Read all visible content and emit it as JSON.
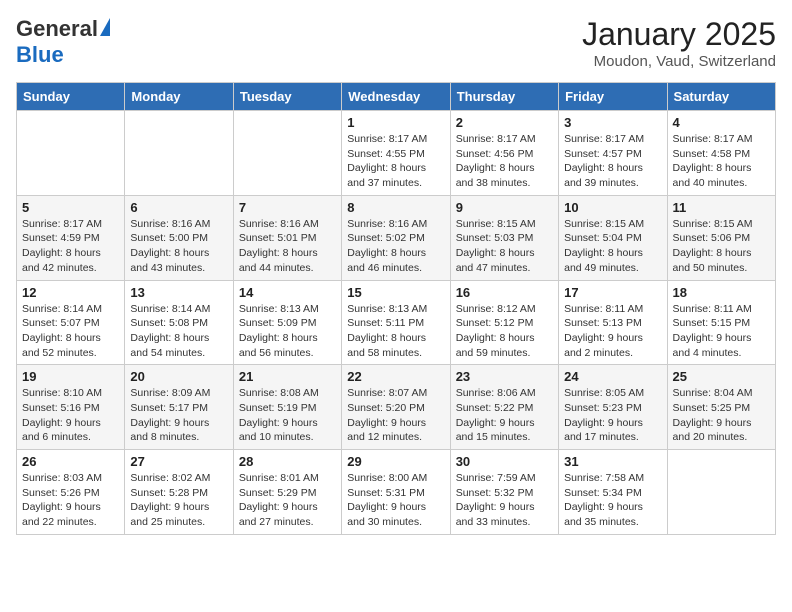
{
  "header": {
    "logo_general": "General",
    "logo_blue": "Blue",
    "title": "January 2025",
    "location": "Moudon, Vaud, Switzerland"
  },
  "days_of_week": [
    "Sunday",
    "Monday",
    "Tuesday",
    "Wednesday",
    "Thursday",
    "Friday",
    "Saturday"
  ],
  "weeks": [
    [
      {
        "day": "",
        "info": ""
      },
      {
        "day": "",
        "info": ""
      },
      {
        "day": "",
        "info": ""
      },
      {
        "day": "1",
        "info": "Sunrise: 8:17 AM\nSunset: 4:55 PM\nDaylight: 8 hours and 37 minutes."
      },
      {
        "day": "2",
        "info": "Sunrise: 8:17 AM\nSunset: 4:56 PM\nDaylight: 8 hours and 38 minutes."
      },
      {
        "day": "3",
        "info": "Sunrise: 8:17 AM\nSunset: 4:57 PM\nDaylight: 8 hours and 39 minutes."
      },
      {
        "day": "4",
        "info": "Sunrise: 8:17 AM\nSunset: 4:58 PM\nDaylight: 8 hours and 40 minutes."
      }
    ],
    [
      {
        "day": "5",
        "info": "Sunrise: 8:17 AM\nSunset: 4:59 PM\nDaylight: 8 hours and 42 minutes."
      },
      {
        "day": "6",
        "info": "Sunrise: 8:16 AM\nSunset: 5:00 PM\nDaylight: 8 hours and 43 minutes."
      },
      {
        "day": "7",
        "info": "Sunrise: 8:16 AM\nSunset: 5:01 PM\nDaylight: 8 hours and 44 minutes."
      },
      {
        "day": "8",
        "info": "Sunrise: 8:16 AM\nSunset: 5:02 PM\nDaylight: 8 hours and 46 minutes."
      },
      {
        "day": "9",
        "info": "Sunrise: 8:15 AM\nSunset: 5:03 PM\nDaylight: 8 hours and 47 minutes."
      },
      {
        "day": "10",
        "info": "Sunrise: 8:15 AM\nSunset: 5:04 PM\nDaylight: 8 hours and 49 minutes."
      },
      {
        "day": "11",
        "info": "Sunrise: 8:15 AM\nSunset: 5:06 PM\nDaylight: 8 hours and 50 minutes."
      }
    ],
    [
      {
        "day": "12",
        "info": "Sunrise: 8:14 AM\nSunset: 5:07 PM\nDaylight: 8 hours and 52 minutes."
      },
      {
        "day": "13",
        "info": "Sunrise: 8:14 AM\nSunset: 5:08 PM\nDaylight: 8 hours and 54 minutes."
      },
      {
        "day": "14",
        "info": "Sunrise: 8:13 AM\nSunset: 5:09 PM\nDaylight: 8 hours and 56 minutes."
      },
      {
        "day": "15",
        "info": "Sunrise: 8:13 AM\nSunset: 5:11 PM\nDaylight: 8 hours and 58 minutes."
      },
      {
        "day": "16",
        "info": "Sunrise: 8:12 AM\nSunset: 5:12 PM\nDaylight: 8 hours and 59 minutes."
      },
      {
        "day": "17",
        "info": "Sunrise: 8:11 AM\nSunset: 5:13 PM\nDaylight: 9 hours and 2 minutes."
      },
      {
        "day": "18",
        "info": "Sunrise: 8:11 AM\nSunset: 5:15 PM\nDaylight: 9 hours and 4 minutes."
      }
    ],
    [
      {
        "day": "19",
        "info": "Sunrise: 8:10 AM\nSunset: 5:16 PM\nDaylight: 9 hours and 6 minutes."
      },
      {
        "day": "20",
        "info": "Sunrise: 8:09 AM\nSunset: 5:17 PM\nDaylight: 9 hours and 8 minutes."
      },
      {
        "day": "21",
        "info": "Sunrise: 8:08 AM\nSunset: 5:19 PM\nDaylight: 9 hours and 10 minutes."
      },
      {
        "day": "22",
        "info": "Sunrise: 8:07 AM\nSunset: 5:20 PM\nDaylight: 9 hours and 12 minutes."
      },
      {
        "day": "23",
        "info": "Sunrise: 8:06 AM\nSunset: 5:22 PM\nDaylight: 9 hours and 15 minutes."
      },
      {
        "day": "24",
        "info": "Sunrise: 8:05 AM\nSunset: 5:23 PM\nDaylight: 9 hours and 17 minutes."
      },
      {
        "day": "25",
        "info": "Sunrise: 8:04 AM\nSunset: 5:25 PM\nDaylight: 9 hours and 20 minutes."
      }
    ],
    [
      {
        "day": "26",
        "info": "Sunrise: 8:03 AM\nSunset: 5:26 PM\nDaylight: 9 hours and 22 minutes."
      },
      {
        "day": "27",
        "info": "Sunrise: 8:02 AM\nSunset: 5:28 PM\nDaylight: 9 hours and 25 minutes."
      },
      {
        "day": "28",
        "info": "Sunrise: 8:01 AM\nSunset: 5:29 PM\nDaylight: 9 hours and 27 minutes."
      },
      {
        "day": "29",
        "info": "Sunrise: 8:00 AM\nSunset: 5:31 PM\nDaylight: 9 hours and 30 minutes."
      },
      {
        "day": "30",
        "info": "Sunrise: 7:59 AM\nSunset: 5:32 PM\nDaylight: 9 hours and 33 minutes."
      },
      {
        "day": "31",
        "info": "Sunrise: 7:58 AM\nSunset: 5:34 PM\nDaylight: 9 hours and 35 minutes."
      },
      {
        "day": "",
        "info": ""
      }
    ]
  ]
}
